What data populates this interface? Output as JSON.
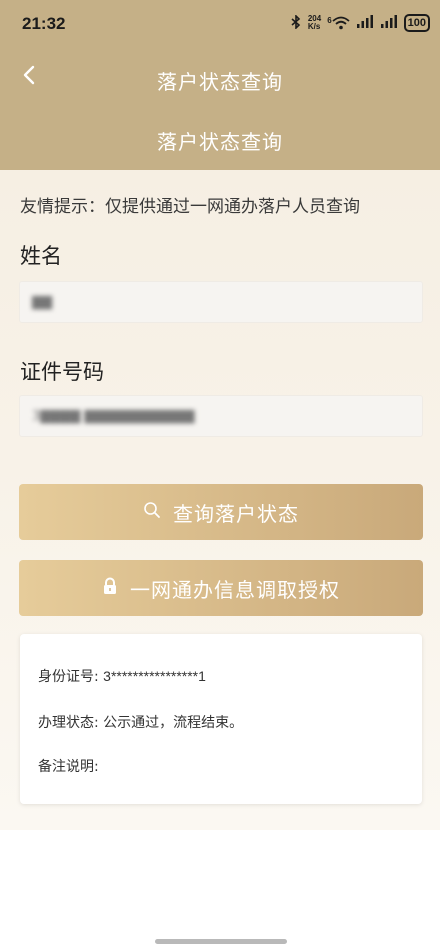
{
  "status_bar": {
    "time": "21:32",
    "net_speed_value": "204",
    "net_speed_unit": "K/s",
    "wifi_generation": "6",
    "battery": "100"
  },
  "nav": {
    "title": "落户状态查询"
  },
  "header": {
    "subtitle": "落户状态查询"
  },
  "notice": "友情提示：仅提供通过一网通办落户人员查询",
  "form": {
    "name_label": "姓名",
    "name_value": "▇▇",
    "id_label": "证件号码",
    "id_value": "3▇▇▇▇ ▇▇▇▇▇▇▇▇▇▇▇"
  },
  "buttons": {
    "query_label": "查询落户状态",
    "auth_label": "一网通办信息调取授权"
  },
  "result": {
    "id_label": "身份证号:",
    "id_value": "3****************1",
    "status_label": "办理状态:",
    "status_value": "公示通过，流程结束。",
    "remark_label": "备注说明:",
    "remark_value": ""
  },
  "colors": {
    "header": "#c5b087",
    "button_start": "#e6cc9a",
    "button_end": "#c9a97a"
  }
}
